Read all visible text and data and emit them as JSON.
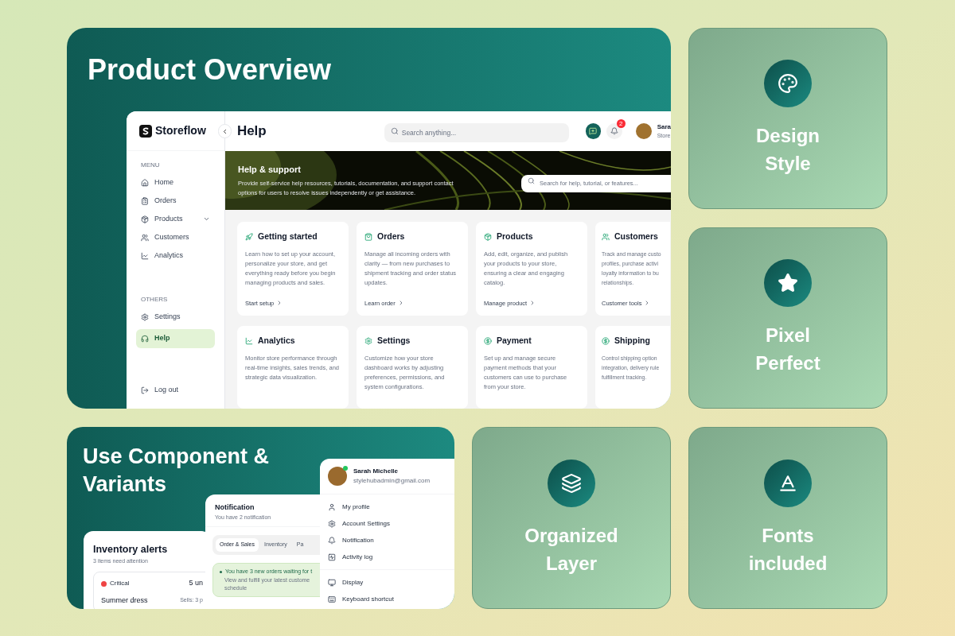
{
  "hero": {
    "title": "Product Overview"
  },
  "app": {
    "brand": "Storeflow",
    "page_title": "Help",
    "search": {
      "placeholder": "Search anything..."
    },
    "notification_count": "2",
    "user": {
      "name": "Sara",
      "role": "Store"
    },
    "sidebar": {
      "sections": [
        {
          "label": "MENU",
          "items": [
            {
              "label": "Home",
              "selected": false,
              "expandable": false
            },
            {
              "label": "Orders",
              "selected": false,
              "expandable": false
            },
            {
              "label": "Products",
              "selected": false,
              "expandable": true
            },
            {
              "label": "Customers",
              "selected": false,
              "expandable": false
            },
            {
              "label": "Analytics",
              "selected": false,
              "expandable": false
            }
          ]
        },
        {
          "label": "OTHERS",
          "items": [
            {
              "label": "Settings",
              "selected": false,
              "expandable": false
            },
            {
              "label": "Help",
              "selected": true,
              "expandable": false
            }
          ]
        }
      ],
      "logout": "Log out"
    },
    "banner": {
      "title": "Help & support",
      "text": "Provide self-service help resources, tutorials, documentation, and support contact options for users to resolve issues independently or get assistance.",
      "search": {
        "placeholder": "Search for help, tutorial, or features..."
      }
    },
    "cards": [
      {
        "title": "Getting started",
        "description": "Learn how to set up your account, personalize your store, and get everything ready before you begin managing products and sales.",
        "link": "Start setup"
      },
      {
        "title": "Orders",
        "description": "Manage all incoming orders with clarity — from new purchases to shipment tracking and order status updates.",
        "link": "Learn order"
      },
      {
        "title": "Products",
        "description": "Add, edit, organize, and publish your products to your store, ensuring a clear and engaging catalog.",
        "link": "Manage product"
      },
      {
        "title": "Customers",
        "description": "Track and manage custo\nprofiles, purchase activi\nloyalty information to bu\nrelationships.",
        "link": "Customer tools"
      },
      {
        "title": "Analytics",
        "description": "Monitor store performance through real-time insights, sales trends, and strategic data visualization."
      },
      {
        "title": "Settings",
        "description": "Customize how your store dashboard works by adjusting preferences, permissions, and system configurations."
      },
      {
        "title": "Payment",
        "description": "Set up and manage secure payment methods that your customers can use to purchase from your store."
      },
      {
        "title": "Shipping",
        "description": "Control shipping option\nintegration, delivery rule\nfulfillment tracking."
      }
    ]
  },
  "features": [
    {
      "title": "Design Style"
    },
    {
      "title": "Pixel Perfect"
    },
    {
      "title": "Organized Layer"
    },
    {
      "title": "Fonts included"
    }
  ],
  "components": {
    "title": "Use Component & Variants",
    "inventory": {
      "title": "Inventory alerts",
      "subtitle": "3 items need attention",
      "alert": {
        "status": "Critical",
        "color": "#ef4444",
        "value": "5 un",
        "item": "Summer dress",
        "sells": "Sells: 3 p"
      }
    },
    "notification": {
      "title": "Notification",
      "subtitle": "You have 2 notification",
      "tabs": [
        {
          "label": "Order & Sales",
          "selected": true
        },
        {
          "label": "Inventory",
          "selected": false
        },
        {
          "label": "Pa",
          "selected": false
        }
      ],
      "message": {
        "title": "You have 3 new orders waiting for t",
        "body": "View and fulfill your latest custome\nschedule"
      }
    },
    "profile_menu": {
      "name": "Sarah Michelle",
      "email": "stylehubadmin@gmail.com",
      "online": true,
      "groups": [
        [
          {
            "label": "My profile"
          },
          {
            "label": "Account Settings"
          },
          {
            "label": "Notification"
          },
          {
            "label": "Activity log"
          }
        ],
        [
          {
            "label": "Display"
          },
          {
            "label": "Keyboard shortcut"
          }
        ]
      ]
    }
  }
}
